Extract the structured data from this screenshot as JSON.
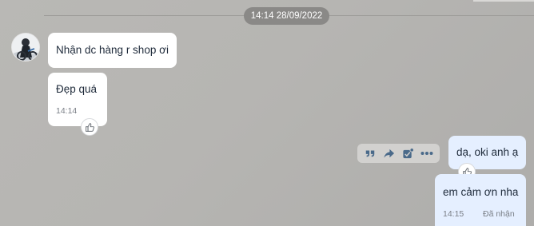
{
  "conversation": {
    "date_separator": "14:14 28/09/2022",
    "messages": [
      {
        "direction": "incoming",
        "text": "Nhận dc hàng r shop ơi"
      },
      {
        "direction": "incoming",
        "text": "Đẹp quá",
        "time": "14:14"
      },
      {
        "direction": "outgoing",
        "text": "dạ, oki anh ạ"
      },
      {
        "direction": "outgoing",
        "text": "em cảm ơn nha",
        "time": "14:15",
        "status": "Đã nhận"
      }
    ]
  },
  "message_actions": [
    "quote-icon",
    "share-icon",
    "mark-task-icon",
    "more-icon"
  ],
  "colors": {
    "background": "#b6b5b2",
    "incoming_bubble": "#ffffff",
    "outgoing_bubble": "#e5efff",
    "date_chip": "#8a8987",
    "action_icons": "#4a6a8a"
  }
}
